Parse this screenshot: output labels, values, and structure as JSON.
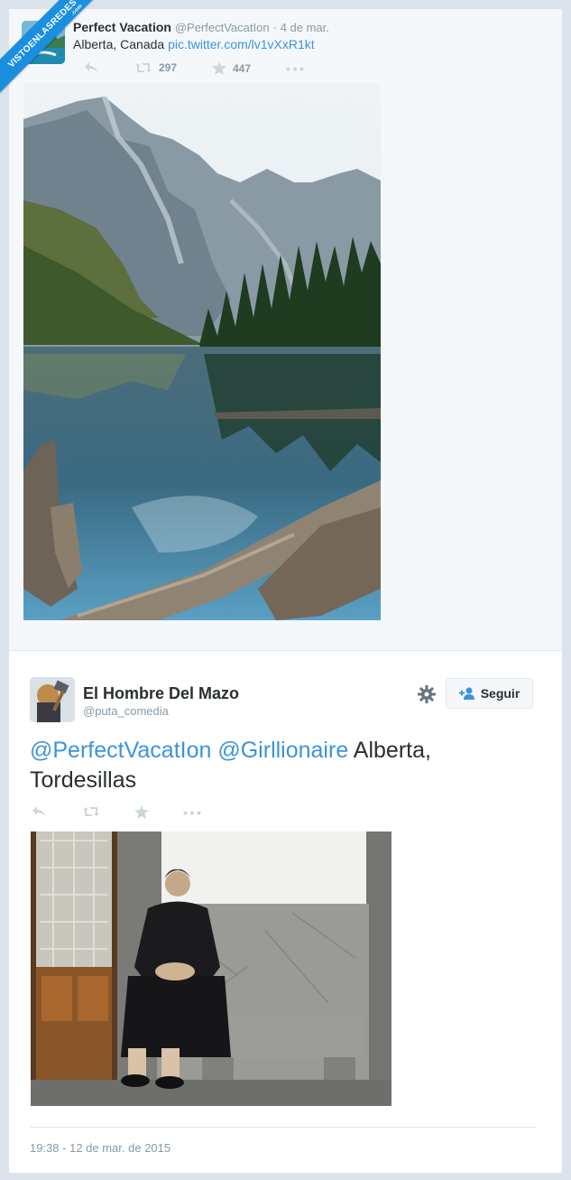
{
  "watermark": {
    "main": "VISTOENLASREDES",
    "sub": ".com"
  },
  "tweet1": {
    "name": "Perfect Vacation",
    "handle": "@PerfectVacatIon",
    "separator": "·",
    "date": "4 de mar.",
    "text_plain": "Alberta, Canada ",
    "text_link": "pic.twitter.com/lv1vXxR1kt",
    "retweets": "297",
    "favorites": "447",
    "icons": {
      "reply": "reply-icon",
      "retweet": "retweet-icon",
      "favorite": "star-icon",
      "more": "more-icon"
    }
  },
  "tweet2": {
    "name": "El Hombre Del Mazo",
    "handle": "@puta_comedia",
    "follow_label": "Seguir",
    "mention1": "@PerfectVacatIon",
    "mention2": "@Girllionaire",
    "text_rest": " Alberta, Tordesillas",
    "timestamp": "19:38 - 12 de mar. de 2015"
  },
  "colors": {
    "link": "#3b94d9",
    "muted": "#8899a6",
    "ribbon": "#1a8fe0"
  }
}
